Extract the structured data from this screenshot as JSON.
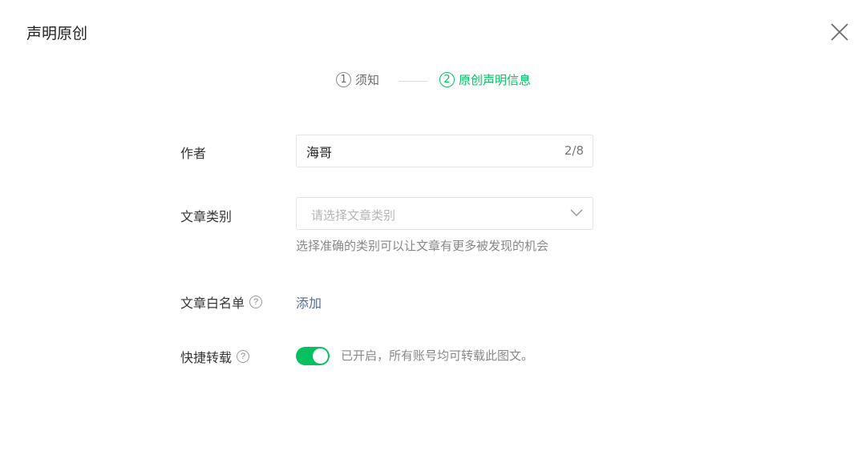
{
  "dialog": {
    "title": "声明原创",
    "close_icon": "close-icon"
  },
  "steps": [
    {
      "number": "1",
      "label": "须知",
      "state": "done"
    },
    {
      "number": "2",
      "label": "原创声明信息",
      "state": "active"
    }
  ],
  "colors": {
    "accent": "#07c160",
    "link": "#576b95",
    "muted": "#888888"
  },
  "form": {
    "author": {
      "label": "作者",
      "value": "海哥",
      "counter": "2/8"
    },
    "category": {
      "label": "文章类别",
      "placeholder": "请选择文章类别",
      "hint": "选择准确的类别可以让文章有更多被发现的机会",
      "icon": "chevron-down-icon"
    },
    "whitelist": {
      "label": "文章白名单",
      "help": "?",
      "action": "添加"
    },
    "quick_repost": {
      "label": "快捷转载",
      "help": "?",
      "enabled": true,
      "status_text": "已开启，所有账号均可转载此图文。"
    }
  }
}
